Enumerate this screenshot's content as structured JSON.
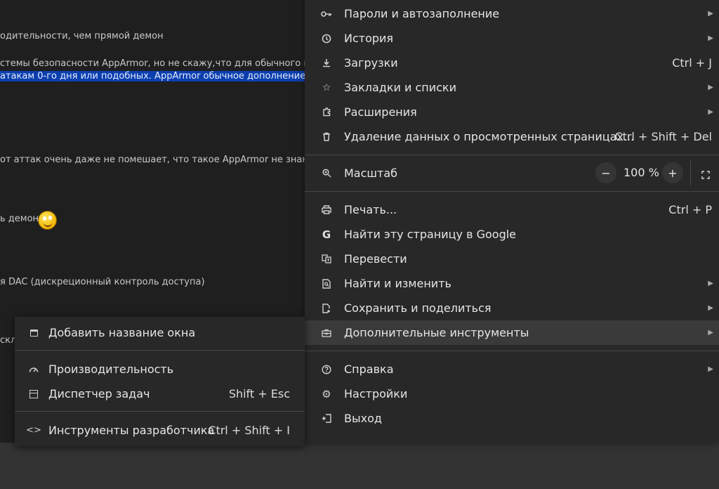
{
  "page": {
    "lines": [
      "одительности, чем прямой демон",
      "стемы безопасности AppArmor, но не скажу,что для обычного испол",
      "атакам 0-го дня или подобных. AppArmor обычное дополнение к ст",
      "от аттак очень даже не помешает, что такое AppArmor не знаю",
      "ь демон",
      "я DAC (дискреционный контроль доступа)",
      "скл"
    ]
  },
  "menu": {
    "passwords": "Пароли и автозаполнение",
    "history": "История",
    "downloads": "Загрузки",
    "downloads_sc": "Ctrl + J",
    "bookmarks": "Закладки и списки",
    "extensions": "Расширения",
    "clear_data": "Удаление данных о просмотренных страницах...",
    "clear_data_sc": "Ctrl + Shift + Del",
    "zoom": "Масштаб",
    "zoom_minus": "−",
    "zoom_value": "100 %",
    "zoom_plus": "+",
    "print": "Печать...",
    "print_sc": "Ctrl + P",
    "find_google": "Найти эту страницу в Google",
    "translate": "Перевести",
    "find_replace": "Найти и изменить",
    "save_share": "Сохранить и поделиться",
    "more_tools": "Дополнительные инструменты",
    "help": "Справка",
    "settings": "Настройки",
    "exit": "Выход"
  },
  "submenu": {
    "name_window": "Добавить название окна",
    "performance": "Производительность",
    "task_manager": "Диспетчер задач",
    "task_manager_sc": "Shift + Esc",
    "devtools": "Инструменты разработчика",
    "devtools_sc": "Ctrl + Shift + I"
  },
  "icons": {
    "key": "key-icon",
    "history": "history-icon",
    "download": "download-icon",
    "star": "star-icon",
    "puzzle": "puzzle-icon",
    "trash": "trash-icon",
    "zoom": "zoom-icon",
    "print": "print-icon",
    "google": "google-icon",
    "translate": "translate-icon",
    "find": "find-icon",
    "share": "share-icon",
    "toolbox": "toolbox-icon",
    "help": "help-icon",
    "gear": "gear-icon",
    "exit": "exit-icon"
  },
  "colors": {
    "menu_bg": "#282828",
    "highlight": "#0b3fae",
    "active_row": "#3a3a3a"
  }
}
